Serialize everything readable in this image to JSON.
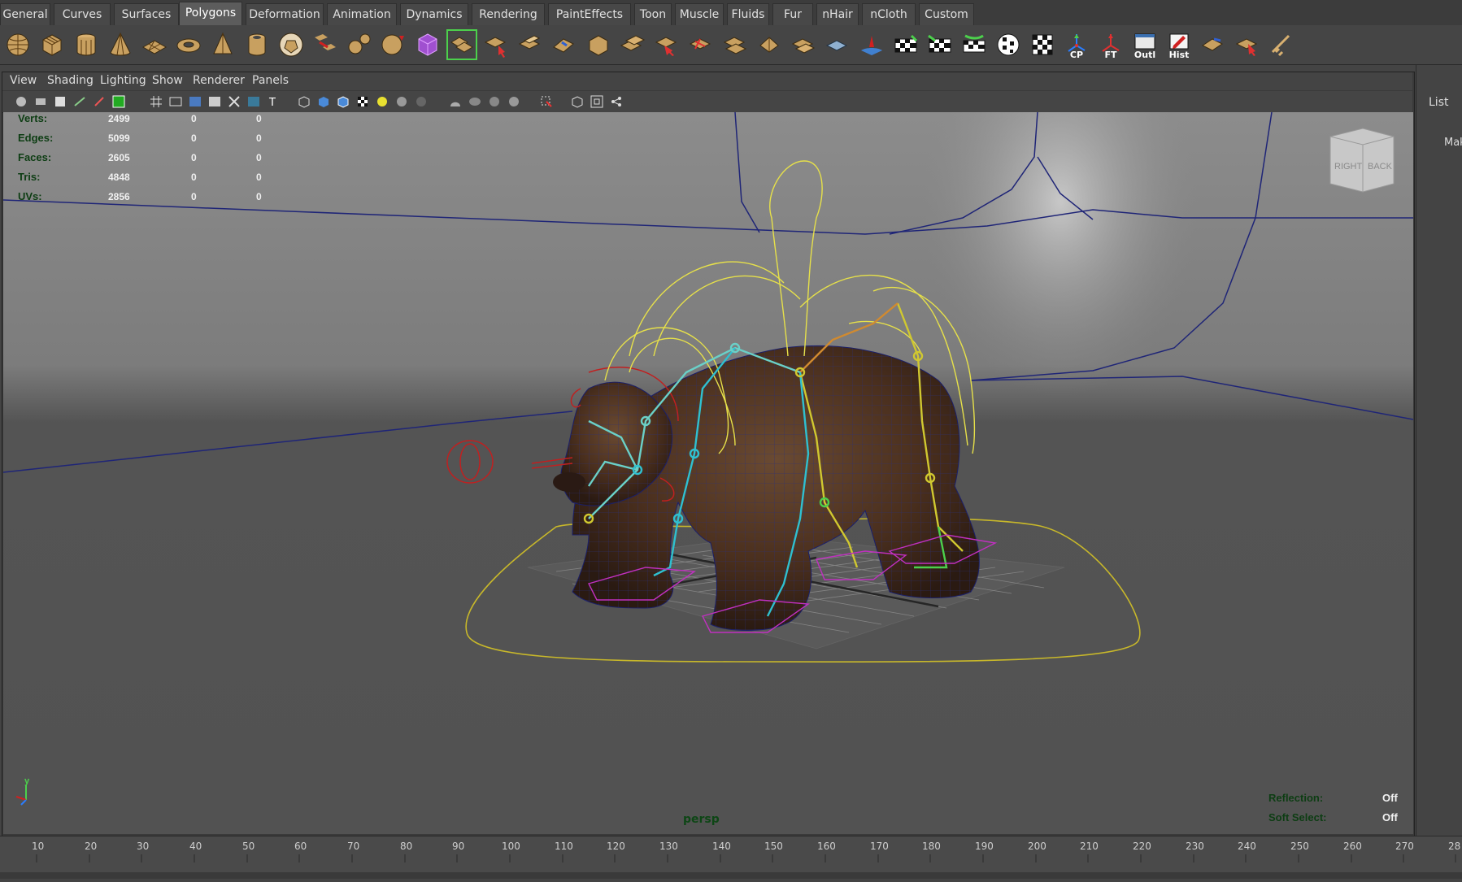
{
  "shelf": {
    "tabs": [
      "General",
      "Curves",
      "Surfaces",
      "Polygons",
      "Deformation",
      "Animation",
      "Dynamics",
      "Rendering",
      "PaintEffects",
      "Toon",
      "Muscle",
      "Fluids",
      "Fur",
      "nHair",
      "nCloth",
      "Custom"
    ],
    "active_tab": "Polygons"
  },
  "toolbar": {
    "labeled_buttons": [
      "CP",
      "FT",
      "Outl",
      "Hist"
    ]
  },
  "panel_menu": [
    "View",
    "Shading",
    "Lighting",
    "Show",
    "Renderer",
    "Panels"
  ],
  "hud": {
    "stats": [
      {
        "label": "Verts:",
        "v1": "2499",
        "v2": "0",
        "v3": "0"
      },
      {
        "label": "Edges:",
        "v1": "5099",
        "v2": "0",
        "v3": "0"
      },
      {
        "label": "Faces:",
        "v1": "2605",
        "v2": "0",
        "v3": "0"
      },
      {
        "label": "Tris:",
        "v1": "4848",
        "v2": "0",
        "v3": "0"
      },
      {
        "label": "UVs:",
        "v1": "2856",
        "v2": "0",
        "v3": "0"
      }
    ],
    "reflection_label": "Reflection:",
    "reflection_value": "Off",
    "softselect_label": "Soft Select:",
    "softselect_value": "Off",
    "camera": "persp",
    "viewcube_right": "RIGHT",
    "viewcube_back": "BACK",
    "axis_y": "y"
  },
  "right_panel": {
    "list_label": "List",
    "mak_label": "Mak"
  },
  "timeline": {
    "ticks": [
      "10",
      "20",
      "30",
      "40",
      "50",
      "60",
      "70",
      "80",
      "90",
      "100",
      "110",
      "120",
      "130",
      "140",
      "150",
      "160",
      "170",
      "180",
      "190",
      "200",
      "210",
      "220",
      "230",
      "240",
      "250",
      "260",
      "270",
      "28"
    ]
  }
}
